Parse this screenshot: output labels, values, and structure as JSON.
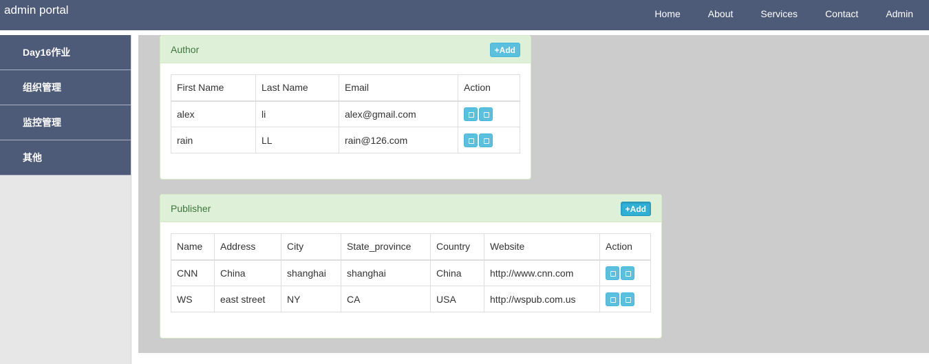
{
  "header": {
    "brand": "admin portal",
    "nav": [
      "Home",
      "About",
      "Services",
      "Contact",
      "Admin"
    ]
  },
  "sidebar": {
    "items": [
      {
        "label": "Day16作业"
      },
      {
        "label": "组织管理"
      },
      {
        "label": "监控管理"
      },
      {
        "label": "其他"
      }
    ]
  },
  "author": {
    "title": "Author",
    "add_label": "+Add",
    "columns": [
      "First Name",
      "Last Name",
      "Email",
      "Action"
    ],
    "rows": [
      {
        "first": "alex",
        "last": "li",
        "email": "alex@gmail.com"
      },
      {
        "first": "rain",
        "last": "LL",
        "email": "rain@126.com"
      }
    ]
  },
  "publisher": {
    "title": "Publisher",
    "add_label": "+Add",
    "columns": [
      "Name",
      "Address",
      "City",
      "State_province",
      "Country",
      "Website",
      "Action"
    ],
    "rows": [
      {
        "name": "CNN",
        "address": "China",
        "city": "shanghai",
        "state": "shanghai",
        "country": "China",
        "website": "http://www.cnn.com"
      },
      {
        "name": "WS",
        "address": "east street",
        "city": "NY",
        "state": "CA",
        "country": "USA",
        "website": "http://wspub.com.us"
      }
    ]
  },
  "colors": {
    "header_bg": "#4d5a78",
    "panel_heading_bg": "#dff0d8",
    "panel_title": "#3c763d",
    "button_info": "#5bc0de",
    "content_bg": "#cccccc"
  },
  "icons": {
    "action_buttons": [
      "edit-icon",
      "delete-icon"
    ]
  }
}
